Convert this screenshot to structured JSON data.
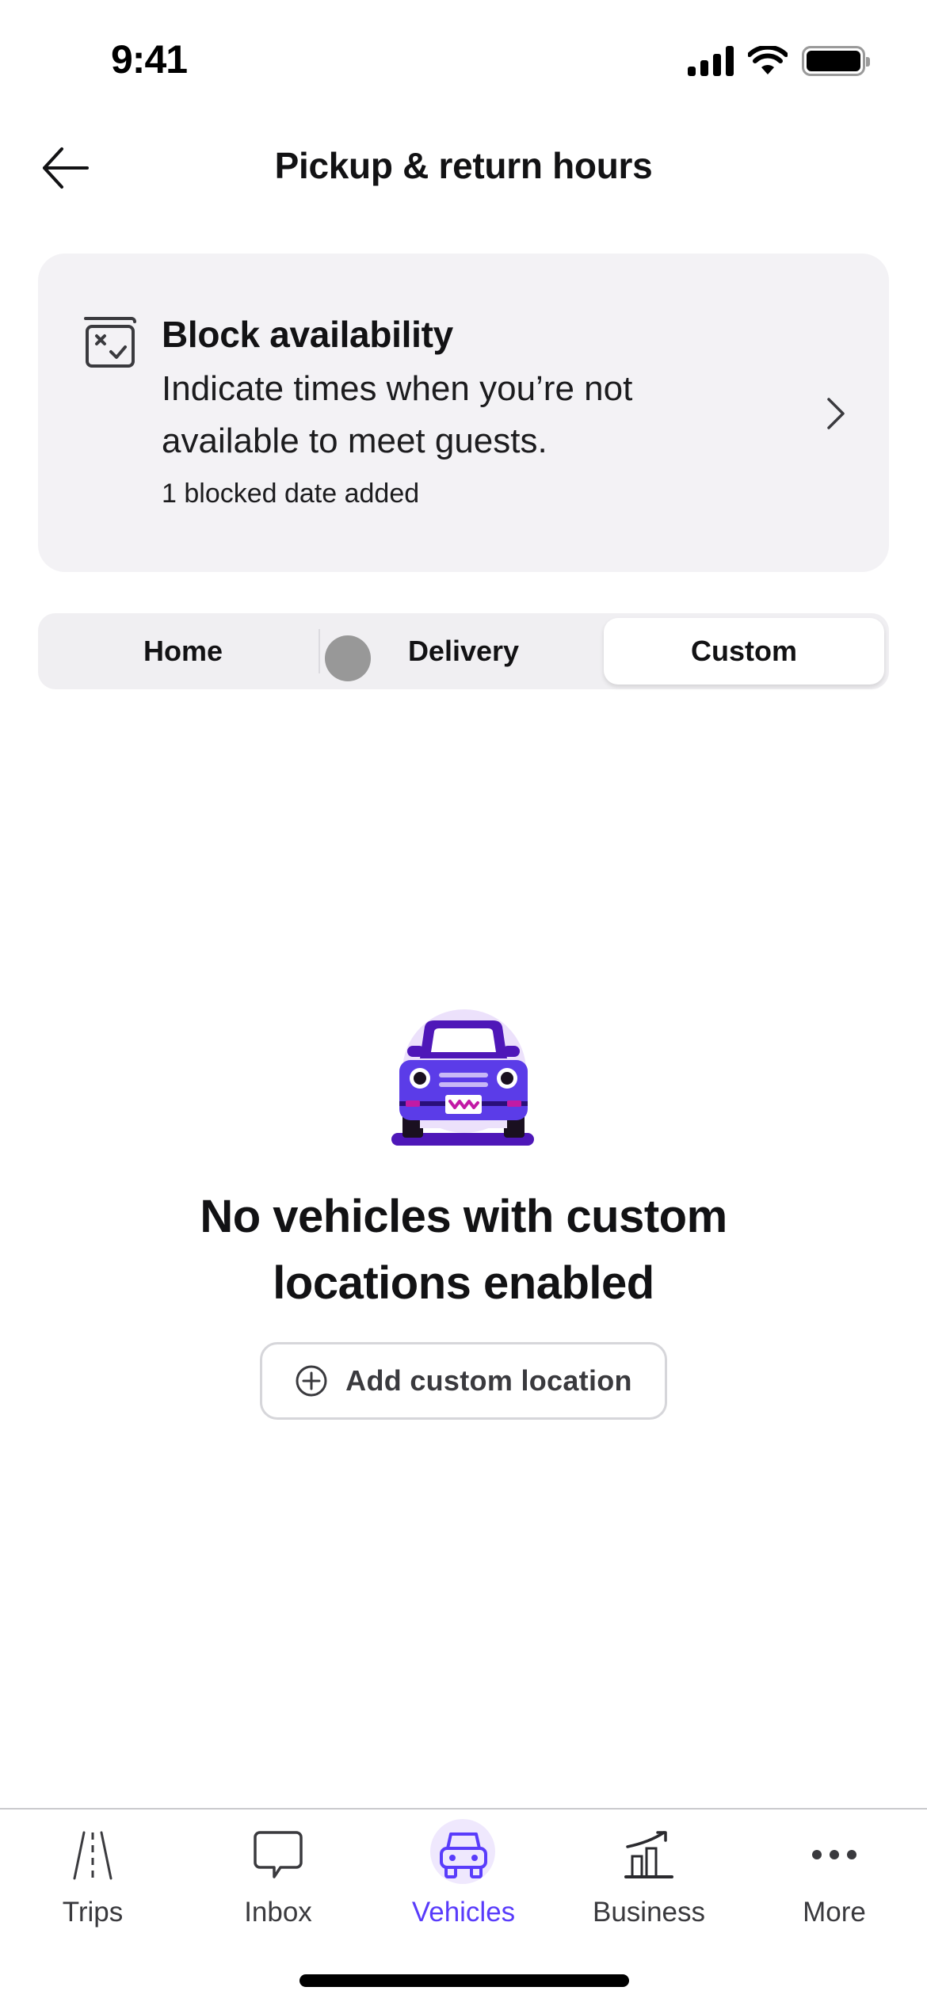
{
  "status_bar": {
    "time": "9:41",
    "icons": [
      "cellular-signal-icon",
      "wifi-icon",
      "battery-icon"
    ]
  },
  "header": {
    "back_icon": "arrow-left-icon",
    "title": "Pickup & return hours"
  },
  "block_availability": {
    "icon": "calendar-block-icon",
    "title": "Block availability",
    "description": "Indicate times when you’re not available to meet guests.",
    "meta": "1 blocked date added",
    "chevron_icon": "chevron-right-icon"
  },
  "segmented_control": {
    "options": [
      {
        "label": "Home",
        "selected": false
      },
      {
        "label": "Delivery",
        "selected": false
      },
      {
        "label": "Custom",
        "selected": true
      }
    ]
  },
  "empty_state": {
    "illustration": "purple-car-illustration",
    "title": "No vehicles with custom locations enabled",
    "button_icon": "plus-circle-icon",
    "button_label": "Add custom location"
  },
  "tab_bar": {
    "tabs": [
      {
        "label": "Trips",
        "icon": "road-icon",
        "active": false
      },
      {
        "label": "Inbox",
        "icon": "chat-bubble-icon",
        "active": false
      },
      {
        "label": "Vehicles",
        "icon": "car-icon",
        "active": true
      },
      {
        "label": "Business",
        "icon": "bar-chart-trend-icon",
        "active": false
      },
      {
        "label": "More",
        "icon": "more-dots-icon",
        "active": false
      }
    ]
  },
  "colors": {
    "accent": "#593cfb",
    "accent_light": "#efe8fd",
    "card_background": "#f3f2f5",
    "text_primary": "#121214",
    "text_secondary": "#3a3a3e"
  }
}
